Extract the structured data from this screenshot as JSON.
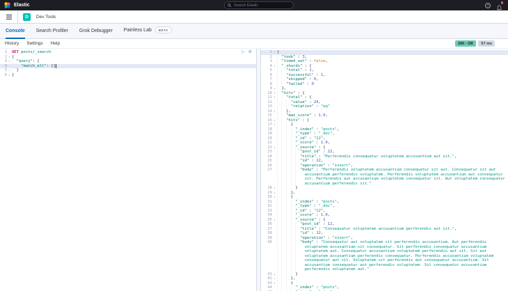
{
  "colors": {
    "header_bg": "#1d1e24",
    "accent_blue": "#006bb4",
    "app_icon_teal": "#00bfb3",
    "success_badge": "#6dccb1",
    "notification_dot": "#f04e98",
    "method_color": "#c80a68",
    "key_color": "#00756c",
    "string_color": "#009688",
    "number_color": "#3c51c5",
    "boolean_color": "#c77500"
  },
  "header": {
    "brand": "Elastic",
    "search_placeholder": "Search Elastic",
    "icons": [
      "help-icon",
      "alerts-bell-icon"
    ]
  },
  "breadcrumb": {
    "app_initial": "D",
    "title": "Dev Tools"
  },
  "tabs": [
    {
      "label": "Console",
      "active": true
    },
    {
      "label": "Search Profiler",
      "active": false
    },
    {
      "label": "Grok Debugger",
      "active": false
    },
    {
      "label": "Painless Lab",
      "active": false,
      "badge": "BETA"
    }
  ],
  "toolbar": {
    "items": [
      "History",
      "Settings",
      "Help"
    ]
  },
  "status": {
    "code_badge": "200 - OK",
    "time_badge": "57 ms"
  },
  "request": {
    "active_line": 4,
    "cursor_line": 4,
    "lines": [
      "GET posts/_search",
      "{",
      "  \"query\": {",
      "    \"match_all\": {}",
      "  }",
      "}"
    ]
  },
  "response": {
    "active_line": 1,
    "lines": [
      "{",
      "  \"took\" : 3,",
      "  \"timed_out\" : false,",
      "  \"_shards\" : {",
      "    \"total\" : 1,",
      "    \"successful\" : 1,",
      "    \"skipped\" : 0,",
      "    \"failed\" : 0",
      "  },",
      "  \"hits\" : {",
      "    \"total\" : {",
      "      \"value\" : 24,",
      "      \"relation\" : \"eq\"",
      "    },",
      "    \"max_score\" : 1.0,",
      "    \"hits\" : [",
      "      {",
      "        \"_index\" : \"posts\",",
      "        \"_type\" : \"_doc\",",
      "        \"_id\" : \"22\",",
      "        \"_score\" : 1.0,",
      "        \"_source\" : {",
      "          \"post_id\" : 22,",
      "          \"title\" : \"Perferendis consequatur voluptatem accusantium aut sit.\",",
      "          \"id\" : 22,",
      "          \"operation\" : \"insert\",",
      "          \"body\" : \"Perferendis voluptatem accusantium consequatur sit aut. Consequatur sit aut accusantium perferendis voluptatem. Perferendis voluptatem accusantium aut consequatur sit. Perferendis aut accusantium voluptatem consequatur sit. Aut voluptatem consequatur accusantium perferendis sit.\"",
      "        }",
      "      },",
      "      {",
      "        \"_index\" : \"posts\",",
      "        \"_type\" : \"_doc\",",
      "        \"_id\" : \"12\",",
      "        \"_score\" : 1.0,",
      "        \"_source\" : {",
      "          \"post_id\" : 12,",
      "          \"title\" : \"Consequatur voluptatem accusantium perferendis aut sit.\",",
      "          \"id\" : 12,",
      "          \"operation\" : \"insert\",",
      "          \"body\" : \"Consequatur aut voluptatem sit perferendis accusantium. Aut perferendis voluptatem accusantium sit consequatur. Sit perferendis consequatur accusantium voluptatem aut. Consequatur accusantium voluptatem perferendis aut sit. Sit aut voluptatem accusantium perferendis consequatur. Perferendis accusantium voluptatem consequatur aut sit. Voluptatem sit perferendis aut consequatur accusantium. Sit accusantium consequatur aut perferendis voluptatem. Sit consequatur accusantium perferendis voluptatem aut.\"",
      "        }",
      "      },",
      "      {",
      "        \"_index\" : \"posts\",",
      "        \"_type\" : \"_doc\","
    ]
  }
}
